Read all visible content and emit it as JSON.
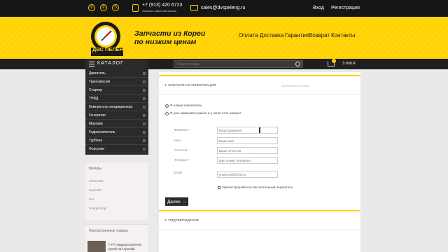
{
  "topbar": {
    "phone": "+7 (913) 420 6723",
    "callback": "Заказать обратный звонок",
    "email": "sales@dvspeleng.ru",
    "login": "Вход",
    "register": "Регистрация"
  },
  "header": {
    "logo_text": "ДВС ПЕЛЕНГ",
    "slogan_line1": "Запчасти из Кореи",
    "slogan_line2": "по низким ценам",
    "nav": [
      "Оплата",
      "Доставка",
      "Гарантия",
      "Возврат",
      "Контакты"
    ]
  },
  "catalog": {
    "label": "КАТАЛОГ",
    "items": [
      "Двигатель",
      "Трансмиссия",
      "Стартер",
      "ТНВД",
      "Компрессор кондиционера",
      "Генератор",
      "Маховик",
      "Гидроусилитель",
      "Турбина",
      "Форсунки"
    ]
  },
  "search": {
    "placeholder": "Поиск товара"
  },
  "cart": {
    "sum": "3 000 ₽"
  },
  "brands": {
    "title": "Бренды",
    "items": [
      "Chevrolet",
      "Hyundai",
      "KIA",
      "SsangYong"
    ]
  },
  "viewed": {
    "title": "Просмотренные товары",
    "product": "ГУР (гидроусилитель руля) на Hyundai"
  },
  "checkout": {
    "section1": "1. КОНТАКТНАЯ ИНФОРМАЦИЯ",
    "section1_link": "ЗАПОЛНИТЬ ФОРМУ",
    "radio_new": "Я новый покупатель",
    "radio_existing": "Я уже заказывал ранее и у меня есть аккаунт",
    "fields": [
      {
        "label": "Фамилия *",
        "placeholder": "Ваша фамилия"
      },
      {
        "label": "Имя",
        "placeholder": "Ваше имя"
      },
      {
        "label": "Отчество",
        "placeholder": "Ваше отчество"
      },
      {
        "label": "Телефон *",
        "placeholder": "ваш номер телефона"
      },
      {
        "label": "Email",
        "placeholder": "yourEmail@mail.ru"
      }
    ],
    "register_checkbox": "Зарегистрироваться как постоянный покупатель",
    "next_button": "Далее →",
    "section2": "2. ПОДТВЕРЖДЕНИЕ"
  }
}
